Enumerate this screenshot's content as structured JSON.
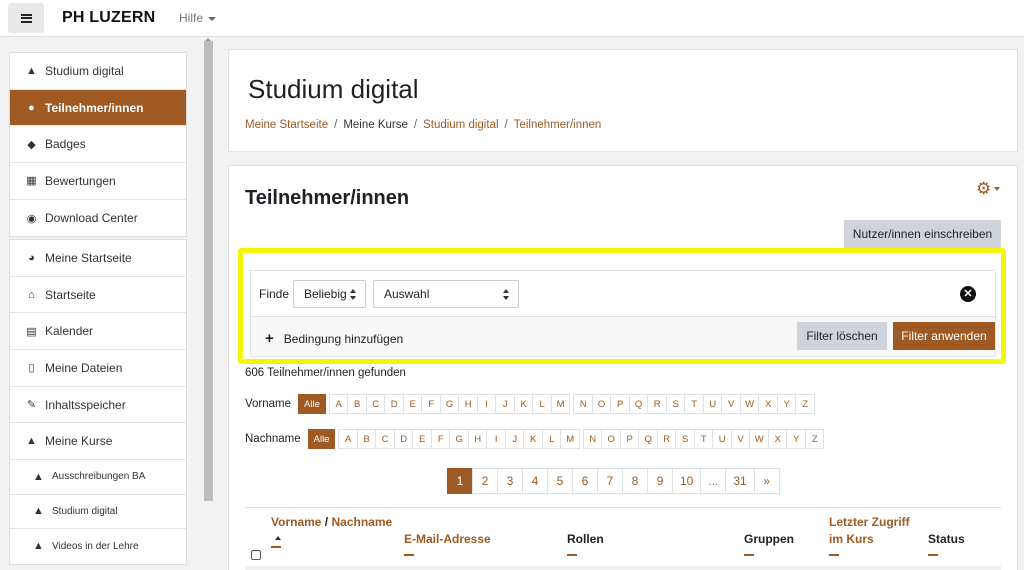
{
  "header": {
    "logo": "PH LUZERN",
    "help": "Hilfe"
  },
  "sidebar": {
    "course_items": [
      {
        "label": "Studium digital",
        "icon": "graduation-cap-icon"
      },
      {
        "label": "Teilnehmer/innen",
        "icon": "users-icon",
        "active": true
      },
      {
        "label": "Badges",
        "icon": "shield-icon"
      },
      {
        "label": "Bewertungen",
        "icon": "table-icon"
      },
      {
        "label": "Download Center",
        "icon": "download-icon"
      }
    ],
    "site_items": [
      {
        "label": "Meine Startseite",
        "icon": "dashboard-icon"
      },
      {
        "label": "Startseite",
        "icon": "home-icon"
      },
      {
        "label": "Kalender",
        "icon": "calendar-icon"
      },
      {
        "label": "Meine Dateien",
        "icon": "file-icon"
      },
      {
        "label": "Inhaltsspeicher",
        "icon": "brush-icon"
      },
      {
        "label": "Meine Kurse",
        "icon": "graduation-cap-icon"
      }
    ],
    "course_list": [
      {
        "label": "Ausschreibungen BA",
        "icon": "graduation-cap-icon"
      },
      {
        "label": "Studium digital",
        "icon": "graduation-cap-icon"
      },
      {
        "label": "Videos in der Lehre",
        "icon": "graduation-cap-icon"
      }
    ]
  },
  "page": {
    "title": "Studium digital",
    "breadcrumb": [
      "Meine Startseite",
      "Meine Kurse",
      "Studium digital",
      "Teilnehmer/innen"
    ]
  },
  "participants": {
    "title": "Teilnehmer/innen",
    "enrol_button": "Nutzer/innen einschreiben",
    "filter": {
      "label": "Finde",
      "match_value": "Beliebig",
      "type_value": "Auswahl",
      "add_condition": "Bedingung hinzufügen",
      "clear_button": "Filter löschen",
      "apply_button": "Filter anwenden"
    },
    "found_text": "606 Teilnehmer/innen gefunden",
    "firstname_label": "Vorname",
    "lastname_label": "Nachname",
    "all_label": "Alle",
    "letters": [
      "A",
      "B",
      "C",
      "D",
      "E",
      "F",
      "G",
      "H",
      "I",
      "J",
      "K",
      "L",
      "M",
      "N",
      "O",
      "P",
      "Q",
      "R",
      "S",
      "T",
      "U",
      "V",
      "W",
      "X",
      "Y",
      "Z"
    ],
    "pages": [
      "1",
      "2",
      "3",
      "4",
      "5",
      "6",
      "7",
      "8",
      "9",
      "10",
      "...",
      "31",
      "»"
    ],
    "columns": {
      "firstname": "Vorname",
      "slash": " / ",
      "lastname": "Nachname",
      "email": "E-Mail-Adresse",
      "roles": "Rollen",
      "groups": "Gruppen",
      "last_access_1": "Letzter Zugriff",
      "last_access_2": "im Kurs",
      "status": "Status"
    }
  },
  "colors": {
    "accent": "#9e5a22",
    "highlight": "#f5f50a"
  }
}
